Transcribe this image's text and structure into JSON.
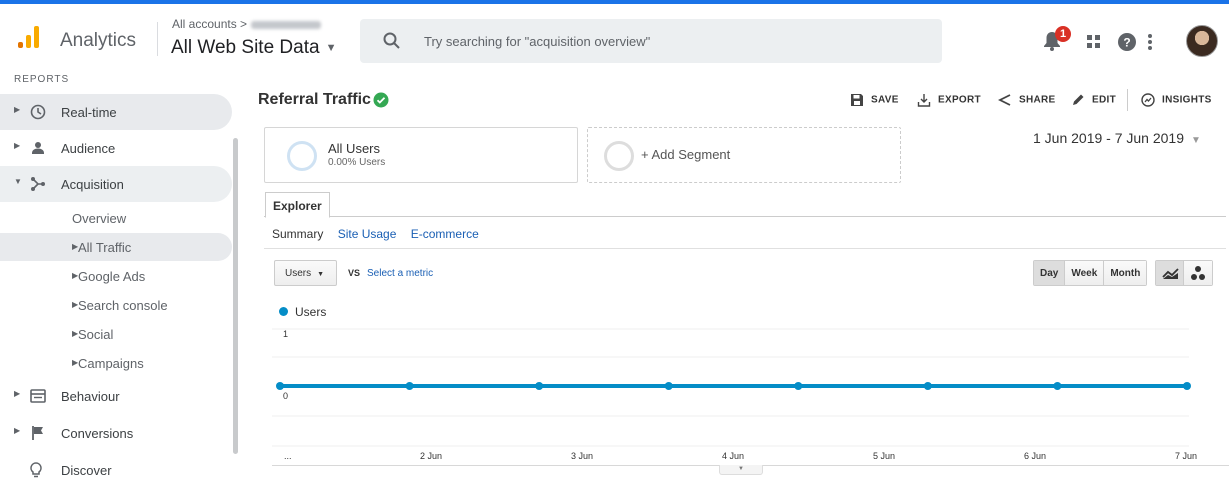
{
  "header": {
    "app_title": "Analytics",
    "account_crumb": "All accounts >",
    "view_name": "All Web Site Data",
    "search_placeholder": "Try searching for \"acquisition overview\"",
    "notification_count": "1",
    "accent_color": "#1a73e8"
  },
  "sidebar": {
    "section_label": "REPORTS",
    "items": [
      {
        "label": "Real-time",
        "icon": "clock-icon"
      },
      {
        "label": "Audience",
        "icon": "person-icon"
      },
      {
        "label": "Acquisition",
        "icon": "acquisition-icon"
      },
      {
        "label": "Behaviour",
        "icon": "behaviour-icon"
      },
      {
        "label": "Conversions",
        "icon": "flag-icon"
      },
      {
        "label": "Discover",
        "icon": "lightbulb-icon"
      }
    ],
    "acquisition_sub": [
      {
        "label": "Overview"
      },
      {
        "label": "All Traffic"
      },
      {
        "label": "Google Ads"
      },
      {
        "label": "Search console"
      },
      {
        "label": "Social"
      },
      {
        "label": "Campaigns"
      }
    ]
  },
  "report": {
    "title": "Referral Traffic",
    "toolbar": {
      "save": "SAVE",
      "export": "EXPORT",
      "share": "SHARE",
      "edit": "EDIT",
      "insights": "INSIGHTS"
    },
    "segment": {
      "name": "All Users",
      "sub": "0.00% Users"
    },
    "add_segment": "+ Add Segment",
    "date_range": "1 Jun 2019 - 7 Jun 2019",
    "explorer_tab": "Explorer",
    "subtabs": [
      "Summary",
      "Site Usage",
      "E-commerce"
    ],
    "metric": "Users",
    "vs": "VS",
    "select_metric": "Select a metric",
    "periods": [
      "Day",
      "Week",
      "Month"
    ],
    "selected_period": "Day"
  },
  "chart_data": {
    "type": "line",
    "legend_position": "top-left",
    "series": [
      {
        "name": "Users",
        "color": "#058dc7",
        "values": [
          0,
          0,
          0,
          0,
          0,
          0,
          0,
          0
        ]
      }
    ],
    "x": [
      "...",
      "2 Jun",
      "3 Jun",
      "4 Jun",
      "5 Jun",
      "6 Jun",
      "7 Jun",
      ""
    ],
    "x_tick_labels": [
      "...",
      "2 Jun",
      "3 Jun",
      "4 Jun",
      "5 Jun",
      "6 Jun",
      "7 Jun"
    ],
    "y_tick_labels": [
      "1",
      "0"
    ],
    "ylim": [
      0,
      1
    ],
    "grid": true
  }
}
